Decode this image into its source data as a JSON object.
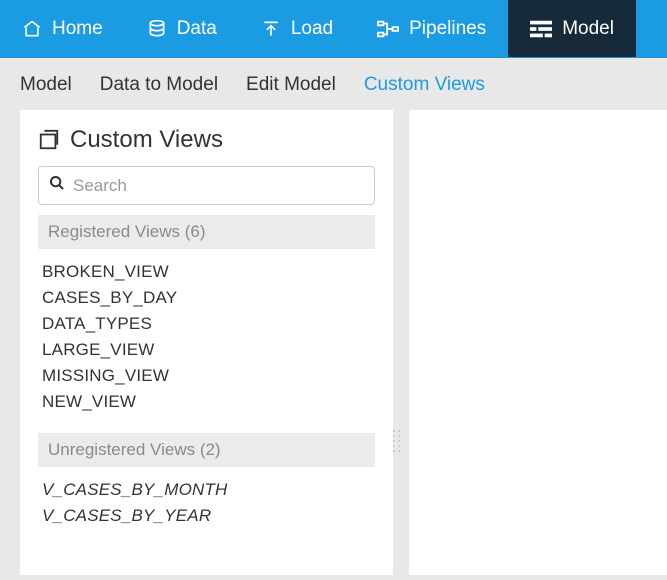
{
  "top_nav": {
    "home": "Home",
    "data": "Data",
    "load": "Load",
    "pipelines": "Pipelines",
    "model": "Model"
  },
  "sub_nav": {
    "model": "Model",
    "data_to_model": "Data to Model",
    "edit_model": "Edit Model",
    "custom_views": "Custom Views"
  },
  "panel": {
    "title": "Custom Views",
    "search_placeholder": "Search"
  },
  "registered": {
    "header": "Registered Views (6)",
    "items": [
      "BROKEN_VIEW",
      "CASES_BY_DAY",
      "DATA_TYPES",
      "LARGE_VIEW",
      "MISSING_VIEW",
      "NEW_VIEW"
    ]
  },
  "unregistered": {
    "header": "Unregistered Views (2)",
    "items": [
      "V_CASES_BY_MONTH",
      "V_CASES_BY_YEAR"
    ]
  }
}
